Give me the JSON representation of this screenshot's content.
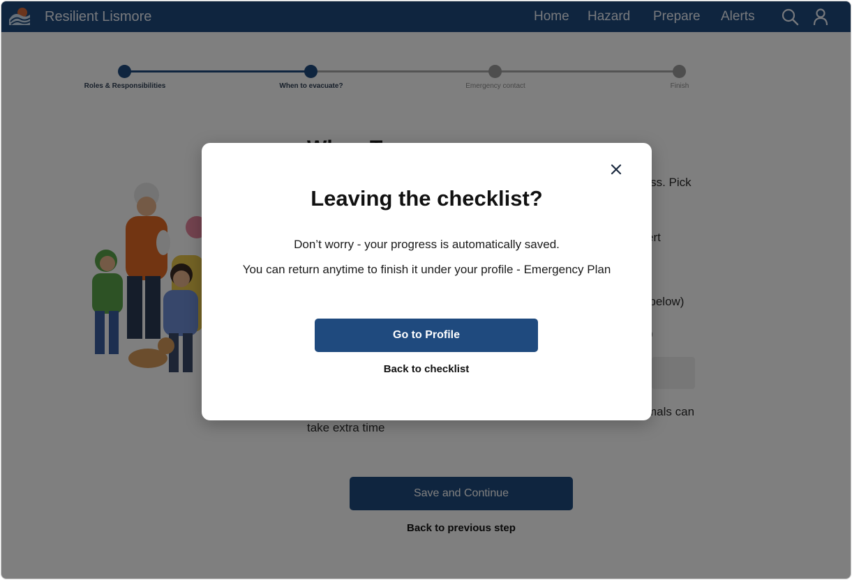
{
  "header": {
    "brand": "Resilient Lismore",
    "nav": [
      "Home",
      "Hazard",
      "Prepare",
      "Alerts"
    ],
    "logo_icon": "wave-logo-icon",
    "search_icon": "search-icon",
    "user_icon": "user-icon"
  },
  "stepper": {
    "steps": [
      {
        "label": "Roles & Responsibilities",
        "status": "done"
      },
      {
        "label": "When to evacuate?",
        "status": "current"
      },
      {
        "label": "Emergency contact",
        "status": "todo"
      },
      {
        "label": "Finish",
        "status": "todo"
      }
    ]
  },
  "background": {
    "heading": "When To",
    "text_fragments": [
      "ress. Pick",
      "ert",
      "r below)",
      ")",
      "mals can",
      "take extra time"
    ],
    "save_label": "Save and Continue",
    "back_label": "Back to previous step"
  },
  "modal": {
    "title": "Leaving the checklist?",
    "line1": "Don’t worry - your progress is automatically saved.",
    "line2": "You can return anytime to finish it under your profile - Emergency Plan",
    "primary_label": "Go to Profile",
    "secondary_label": "Back to checklist",
    "close_icon": "close-icon"
  },
  "colors": {
    "brand": "#1f4a7e",
    "overlay": "rgba(0,0,0,0.5)"
  }
}
